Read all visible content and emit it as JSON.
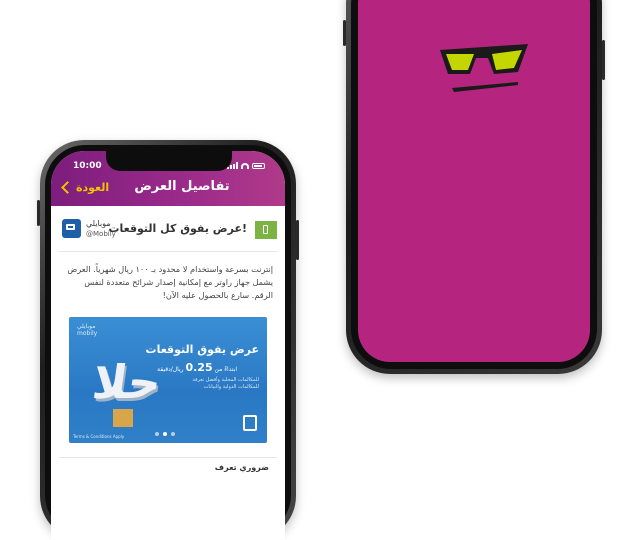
{
  "status_bar": {
    "time": "10:00"
  },
  "app_bar": {
    "title": "تفاصيل العرض",
    "back_label": "العودة"
  },
  "offer": {
    "account_name": "موبايلي",
    "account_handle": "@Mobily",
    "title": "عرض يفوق كل التوقعات!",
    "description": "إنترنت بسرعة واستخدام لا محدود بـ ١٠٠ ريال شهرياً. العرض يشمل جهاز راوتر مع إمكانية إصدار شرائح متعددة لنفس الرقم. سارع بالحصول عليه الآن!"
  },
  "banner": {
    "logo_ar": "موبايلي",
    "logo_en": "mobily",
    "title": "عرض يفوق التوقعات",
    "price_prefix": "ابتداءً من",
    "price_value": "0.25",
    "price_suffix": "ريال/دقيقة",
    "line1": "للمكالمات المحلية وأفضل تعرفة",
    "line2": "للمكالمات الدولية والبيانات",
    "hala_text": "حلا",
    "footer": "Terms & Conditions Apply",
    "dots_count": 3,
    "active_dot": 1
  },
  "section": {
    "title": "ضروري تعرف"
  },
  "colors": {
    "brand_purple": "#b5257f",
    "appbar_start": "#7d1d7d",
    "back_yellow": "#f1c400",
    "offer_green": "#7cb342",
    "banner_blue": "#2a78c4"
  },
  "icons": {
    "brand_logo": "sunglasses-logo-icon",
    "back": "chevron-left-icon",
    "offer": "mobile-phone-icon"
  }
}
